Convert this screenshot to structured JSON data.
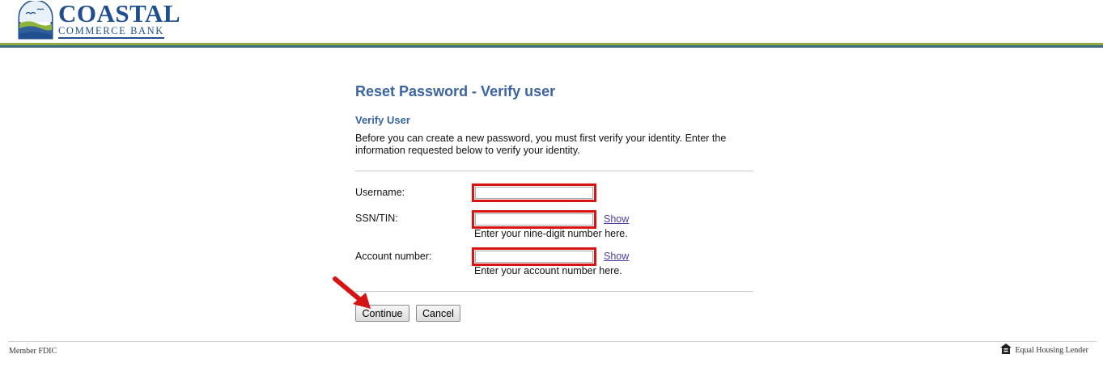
{
  "header": {
    "logo_line1": "COASTAL",
    "logo_line2": "COMMERCE BANK",
    "colors": {
      "brand_blue": "#1f4f8f",
      "rule_green": "#93a83a",
      "rule_blue": "#3d6c86"
    }
  },
  "main": {
    "page_title": "Reset Password - Verify user",
    "section_title": "Verify User",
    "instructions": "Before you can create a new password, you must first verify your identity. Enter the information requested below to verify your identity.",
    "fields": {
      "username": {
        "label": "Username:",
        "value": ""
      },
      "ssn": {
        "label": "SSN/TIN:",
        "value": "",
        "show_label": "Show",
        "hint": "Enter your nine-digit number here."
      },
      "account": {
        "label": "Account number:",
        "value": "",
        "show_label": "Show",
        "hint": "Enter your account number here."
      }
    },
    "buttons": {
      "continue": "Continue",
      "cancel": "Cancel"
    },
    "highlight_color": "#d81313"
  },
  "footer": {
    "left": "Member FDIC",
    "right": "Equal Housing Lender",
    "right_icon": "equal-housing-icon"
  }
}
